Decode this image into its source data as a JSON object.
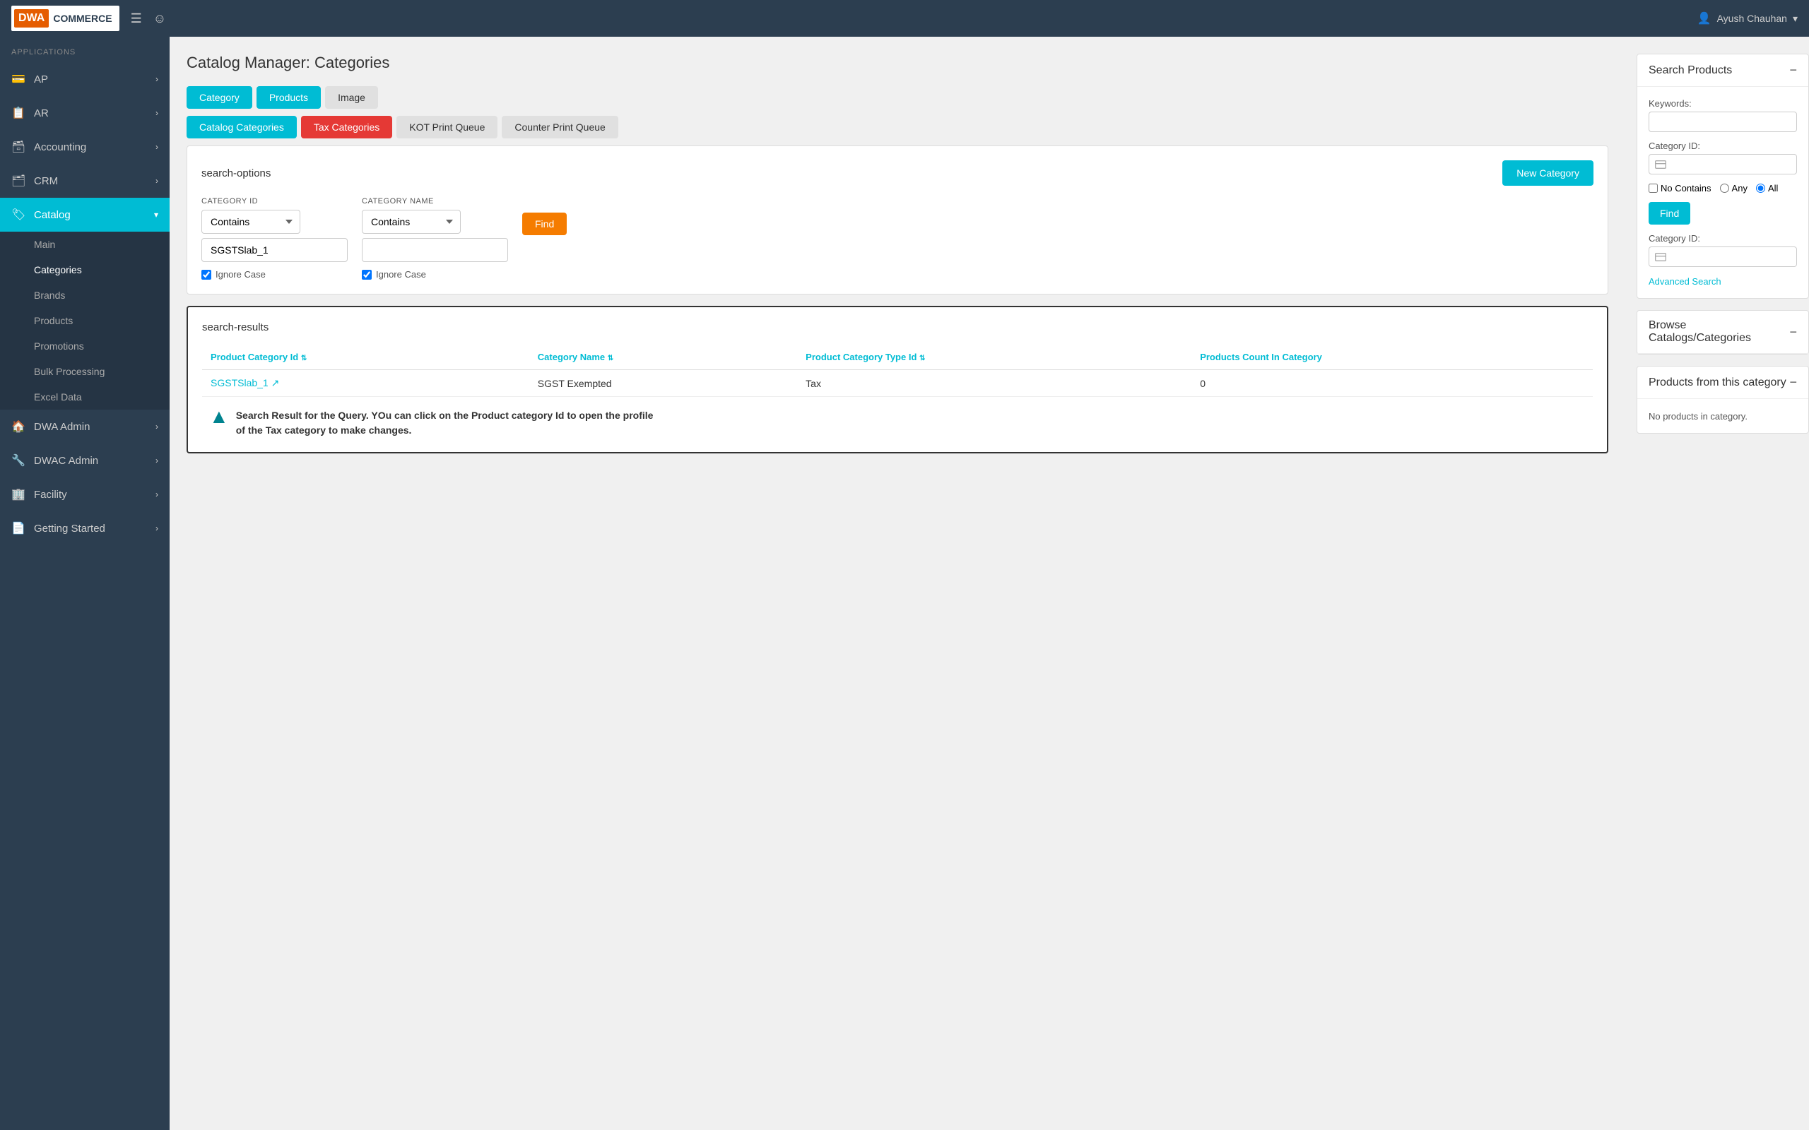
{
  "app": {
    "logo_dwa": "DWA",
    "logo_commerce": "COMMERCE",
    "user": "Ayush Chauhan",
    "topbar_menu_icon": "☰",
    "topbar_help_icon": "☺"
  },
  "sidebar": {
    "section_label": "APPLICATIONS",
    "items": [
      {
        "id": "ap",
        "label": "AP",
        "icon": "💳",
        "has_arrow": true,
        "active": false
      },
      {
        "id": "ar",
        "label": "AR",
        "icon": "📋",
        "has_arrow": true,
        "active": false
      },
      {
        "id": "accounting",
        "label": "Accounting",
        "icon": "🗃",
        "has_arrow": true,
        "active": false
      },
      {
        "id": "crm",
        "label": "CRM",
        "icon": "🗂",
        "has_arrow": true,
        "active": false
      },
      {
        "id": "catalog",
        "label": "Catalog",
        "icon": "🏷",
        "has_arrow": true,
        "active": true
      }
    ],
    "catalog_sub": [
      {
        "id": "main",
        "label": "Main"
      },
      {
        "id": "categories",
        "label": "Categories"
      },
      {
        "id": "brands",
        "label": "Brands"
      },
      {
        "id": "products",
        "label": "Products"
      },
      {
        "id": "promotions",
        "label": "Promotions"
      },
      {
        "id": "bulk_processing",
        "label": "Bulk Processing"
      },
      {
        "id": "excel_data",
        "label": "Excel Data"
      }
    ],
    "bottom_items": [
      {
        "id": "dwa_admin",
        "label": "DWA Admin",
        "icon": "🏠",
        "has_arrow": true
      },
      {
        "id": "dwac_admin",
        "label": "DWAC Admin",
        "icon": "🔧",
        "has_arrow": true
      },
      {
        "id": "facility",
        "label": "Facility",
        "icon": "🏢",
        "has_arrow": true
      },
      {
        "id": "getting_started",
        "label": "Getting Started",
        "icon": "📄",
        "has_arrow": true
      }
    ]
  },
  "page": {
    "title": "Catalog Manager: Categories",
    "tabs_row1": [
      {
        "id": "category",
        "label": "Category",
        "style": "teal"
      },
      {
        "id": "products",
        "label": "Products",
        "style": "teal"
      },
      {
        "id": "image",
        "label": "Image",
        "style": "grey"
      }
    ],
    "tabs_row2": [
      {
        "id": "catalog_categories",
        "label": "Catalog Categories",
        "style": "teal"
      },
      {
        "id": "tax_categories",
        "label": "Tax Categories",
        "style": "red"
      },
      {
        "id": "kot_print_queue",
        "label": "KOT Print Queue",
        "style": "grey"
      },
      {
        "id": "counter_print_queue",
        "label": "Counter Print Queue",
        "style": "grey"
      }
    ]
  },
  "search_options": {
    "title": "search-options",
    "new_category_label": "New Category",
    "category_id_label": "CATEGORY ID",
    "category_name_label": "CATEGORY NAME",
    "contains_option": "Contains",
    "category_id_value": "SGSTSlab_1",
    "category_name_value": "",
    "ignore_case_1": "Ignore Case",
    "ignore_case_2": "Ignore Case",
    "find_label": "Find"
  },
  "search_results": {
    "title": "search-results",
    "columns": [
      {
        "id": "product_category_id",
        "label": "Product Category Id"
      },
      {
        "id": "category_name",
        "label": "Category Name"
      },
      {
        "id": "product_category_type_id",
        "label": "Product Category Type Id"
      },
      {
        "id": "products_count",
        "label": "Products Count In Category"
      }
    ],
    "rows": [
      {
        "product_category_id": "SGSTSlab_1",
        "category_name": "SGST Exempted",
        "product_category_type_id": "Tax",
        "products_count": "0"
      }
    ],
    "tooltip_text": "Search Result for the Query. YOu can click on the Product category Id to open the profile of the Tax category to make changes."
  },
  "right_panel": {
    "search_products": {
      "title": "Search Products",
      "keywords_label": "Keywords:",
      "keywords_placeholder": "",
      "category_id_label": "Category ID:",
      "no_contains_label": "No Contains",
      "any_label": "Any",
      "all_label": "All",
      "find_label": "Find",
      "category_id_2_label": "Category ID:",
      "advanced_search_label": "Advanced Search"
    },
    "browse_catalogs": {
      "title": "Browse Catalogs/Categories"
    },
    "products_from_category": {
      "title": "Products from this category",
      "no_products_label": "No products in category."
    }
  }
}
